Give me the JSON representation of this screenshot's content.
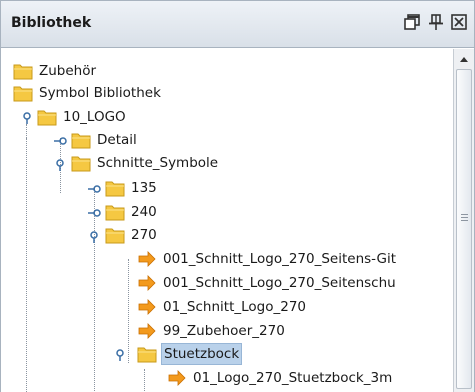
{
  "panel": {
    "title": "Bibliothek",
    "buttons": {
      "float_icon": "float-window-icon",
      "pin_icon": "pin-icon",
      "close_icon": "close-icon"
    }
  },
  "tree": {
    "items": [
      {
        "label": "Zubehör",
        "type": "folder"
      },
      {
        "label": "Symbol Bibliothek",
        "type": "folder"
      },
      {
        "label": "10_LOGO",
        "type": "folder",
        "expanded": true
      },
      {
        "label": "Detail",
        "type": "folder",
        "expanded": false
      },
      {
        "label": "Schnitte_Symbole",
        "type": "folder",
        "expanded": true
      },
      {
        "label": "135",
        "type": "folder",
        "expanded": false
      },
      {
        "label": "240",
        "type": "folder",
        "expanded": false
      },
      {
        "label": "270",
        "type": "folder",
        "expanded": true
      },
      {
        "label": "001_Schnitt_Logo_270_Seitens-Git",
        "type": "symbol"
      },
      {
        "label": "001_Schnitt_Logo_270_Seitenschu",
        "type": "symbol"
      },
      {
        "label": "01_Schnitt_Logo_270",
        "type": "symbol"
      },
      {
        "label": "99_Zubehoer_270",
        "type": "symbol"
      },
      {
        "label": "Stuetzbock",
        "type": "folder",
        "expanded": true,
        "selected": true
      },
      {
        "label": "01_Logo_270_Stuetzbock_3m",
        "type": "symbol"
      }
    ]
  },
  "colors": {
    "folder": "#f5c842",
    "symbol_arrow": "#f39a1d",
    "selection": "#b9d1ea"
  }
}
